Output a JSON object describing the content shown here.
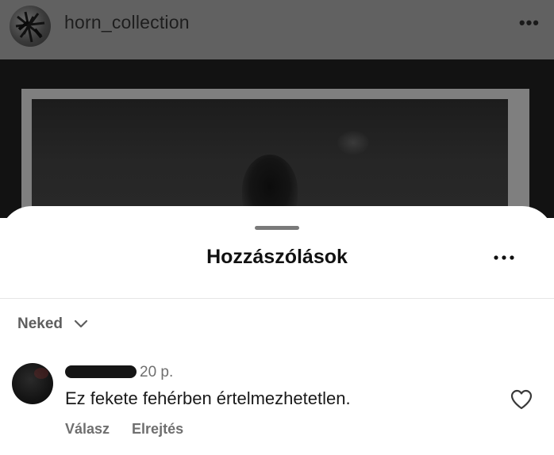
{
  "post": {
    "username": "horn_collection",
    "more_icon": "more-horizontal-icon"
  },
  "comments_sheet": {
    "title": "Hozzászólások",
    "more_icon": "more-horizontal-icon",
    "sort_label": "Neked",
    "sort_icon": "chevron-down-icon"
  },
  "comment": {
    "time": "20 p.",
    "text": "Ez fekete fehérben értelmezhetetlen.",
    "reply_label": "Válasz",
    "hide_label": "Elrejtés",
    "like_icon": "heart-outline-icon"
  }
}
